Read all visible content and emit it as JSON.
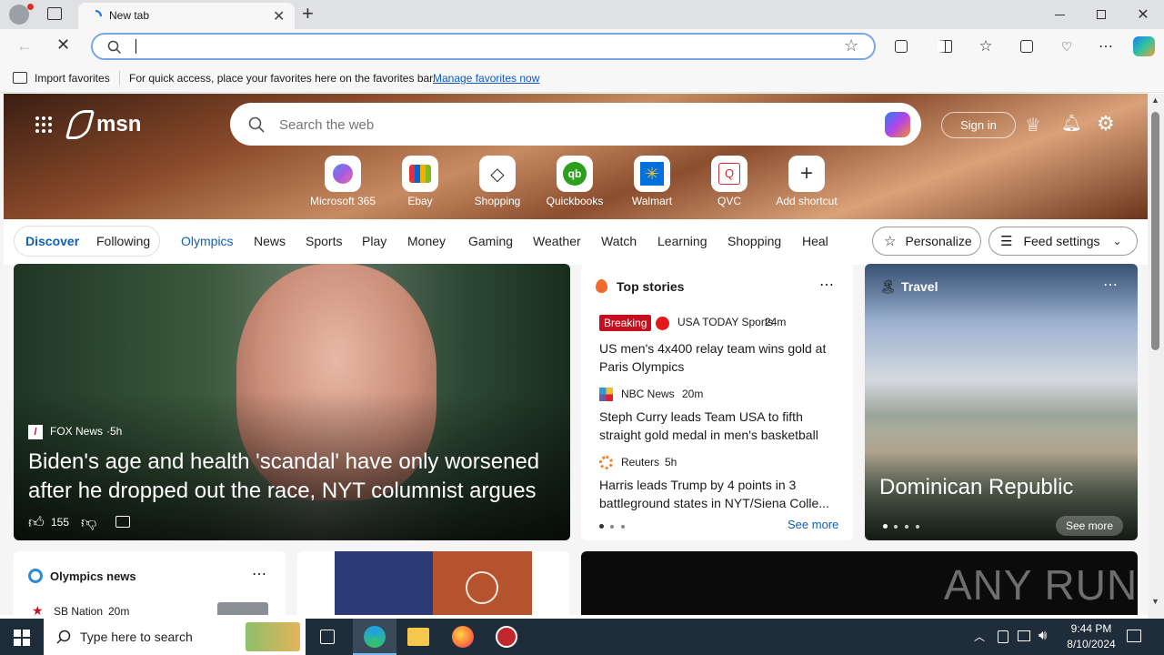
{
  "browser": {
    "tab_title": "New tab",
    "favorites_bar": {
      "import_label": "Import favorites",
      "hint": "For quick access, place your favorites here on the favorites bar.",
      "manage_link": "Manage favorites now"
    },
    "address_value": ""
  },
  "msn": {
    "logo": "msn",
    "search_placeholder": "Search the web",
    "sign_in": "Sign in",
    "shortcuts": [
      {
        "label": "Microsoft 365",
        "color": "#6b5cd8"
      },
      {
        "label": "Ebay",
        "color": "#e53238"
      },
      {
        "label": "Shopping",
        "color": "#333333"
      },
      {
        "label": "Quickbooks",
        "color": "#2ca01c"
      },
      {
        "label": "Walmart",
        "color": "#0071dc"
      },
      {
        "label": "QVC",
        "color": "#d2282e"
      },
      {
        "label": "Add shortcut",
        "color": "#333333"
      }
    ],
    "feed_tabs": {
      "discover": "Discover",
      "following": "Following"
    },
    "nav": [
      "Olympics",
      "News",
      "Sports",
      "Play",
      "Money",
      "Gaming",
      "Weather",
      "Watch",
      "Learning",
      "Shopping",
      "Heal"
    ],
    "personalize": "Personalize",
    "feed_settings": "Feed settings"
  },
  "hero_story": {
    "source": "FOX News",
    "age": "5h",
    "headline": "Biden's age and health 'scandal' have only worsened after he dropped out the race, NYT columnist argues",
    "likes": "155"
  },
  "top_stories": {
    "title": "Top stories",
    "items": [
      {
        "badge": "Breaking",
        "source": "USA TODAY Sports",
        "age": "24m",
        "headline": "US men's 4x400 relay team wins gold at Paris Olympics"
      },
      {
        "source": "NBC News",
        "age": "20m",
        "headline": "Steph Curry leads Team USA to fifth straight gold medal in men's basketball"
      },
      {
        "source": "Reuters",
        "age": "5h",
        "headline": "Harris leads Trump by 4 points in 3 battleground states in NYT/Siena Colle..."
      }
    ],
    "see_more": "See more"
  },
  "travel": {
    "label": "Travel",
    "title": "Dominican Republic",
    "see_more": "See more"
  },
  "olympics_news": {
    "title": "Olympics news",
    "item_source": "SB Nation",
    "item_age": "20m"
  },
  "watermark": "ANY RUN",
  "taskbar": {
    "search_placeholder": "Type here to search",
    "time": "9:44 PM",
    "date": "8/10/2024"
  }
}
